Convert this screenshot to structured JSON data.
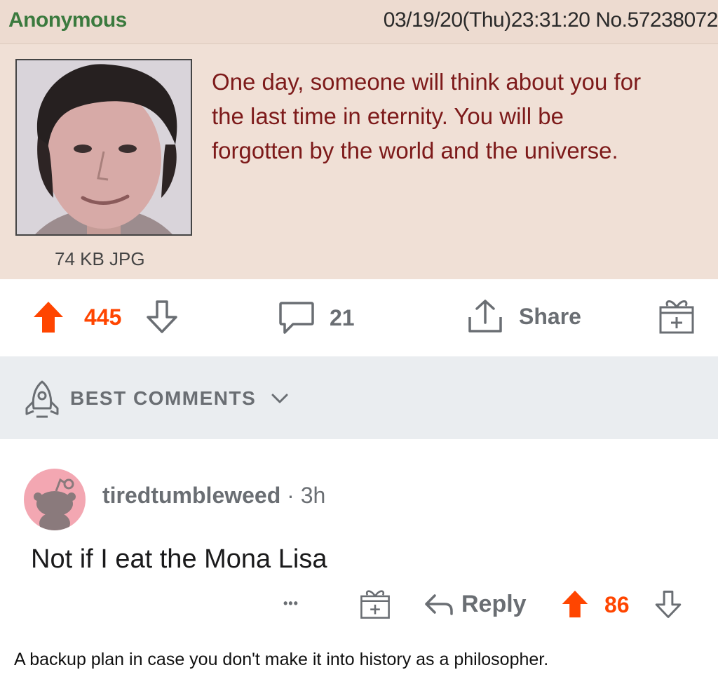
{
  "post": {
    "name": "Anonymous",
    "meta": "03/19/20(Thu)23:31:20 No.57238072",
    "text_lines": [
      "One day, someone will think about you for",
      "the last time in eternity. You will be",
      "forgotten by the world and the universe."
    ],
    "file_info": "74 KB JPG"
  },
  "actions": {
    "upvotes": "445",
    "comments": "21",
    "share_label": "Share"
  },
  "sort": {
    "label": "BEST COMMENTS"
  },
  "comment": {
    "author": "tiredtumbleweed",
    "time": "3h",
    "body": "Not if I eat the Mona Lisa",
    "more": "•••",
    "reply_label": "Reply",
    "votes": "86"
  },
  "caption": "A backup plan in case you don't make it into history as a philosopher.",
  "colors": {
    "upvote": "#ff4500",
    "name_green": "#3b7a3e",
    "post_text": "#7d1a1a",
    "post_bg": "#f0e0d6",
    "sort_bg": "#eaedf0",
    "icon_gray": "#6a6e73"
  },
  "icons": [
    "upvote-icon",
    "downvote-icon",
    "comment-icon",
    "share-icon",
    "award-icon",
    "rocket-icon",
    "chevron-down-icon",
    "snoo-avatar-icon",
    "reply-icon"
  ]
}
